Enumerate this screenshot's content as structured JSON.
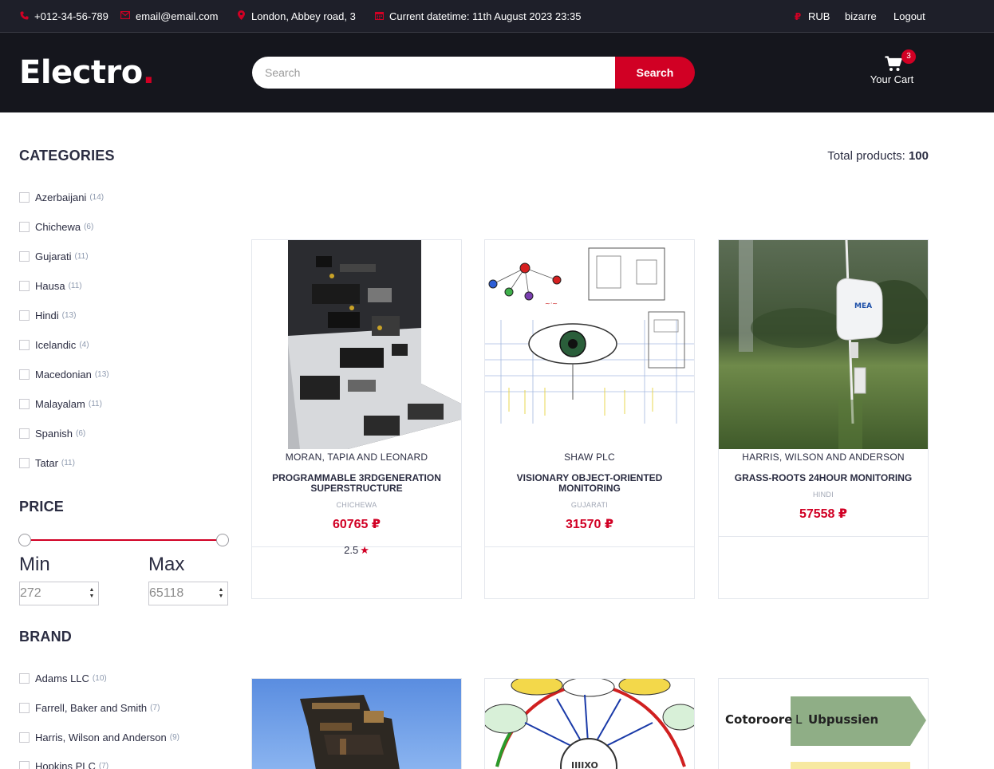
{
  "topbar": {
    "phone": "+012-34-56-789",
    "email": "email@email.com",
    "address": "London, Abbey road, 3",
    "datetime": "Current datetime: 11th August 2023 23:35",
    "currency": "RUB",
    "username": "bizarre",
    "logout": "Logout"
  },
  "header": {
    "logo_text": "Electro",
    "logo_dot": ".",
    "search_placeholder": "Search",
    "search_button": "Search",
    "cart_count": "3",
    "cart_label": "Your Cart"
  },
  "sidebar": {
    "categories_title": "CATEGORIES",
    "categories": [
      {
        "label": "Azerbaijani",
        "count": "(14)"
      },
      {
        "label": "Chichewa",
        "count": "(6)"
      },
      {
        "label": "Gujarati",
        "count": "(11)"
      },
      {
        "label": "Hausa",
        "count": "(11)"
      },
      {
        "label": "Hindi",
        "count": "(13)"
      },
      {
        "label": "Icelandic",
        "count": "(4)"
      },
      {
        "label": "Macedonian",
        "count": "(13)"
      },
      {
        "label": "Malayalam",
        "count": "(11)"
      },
      {
        "label": "Spanish",
        "count": "(6)"
      },
      {
        "label": "Tatar",
        "count": "(11)"
      }
    ],
    "price_title": "PRICE",
    "min_label": "Min",
    "max_label": "Max",
    "min_value": "272",
    "max_value": "65118",
    "brand_title": "BRAND",
    "brands": [
      {
        "label": "Adams LLC",
        "count": "(10)"
      },
      {
        "label": "Farrell, Baker and Smith",
        "count": "(7)"
      },
      {
        "label": "Harris, Wilson and Anderson",
        "count": "(9)"
      },
      {
        "label": "Hopkins PLC",
        "count": "(7)"
      }
    ]
  },
  "main": {
    "total_label": "Total products:",
    "total_value": "100",
    "products": [
      {
        "brand": "Moran, Tapia and Leonard",
        "name": "Programmable 3rdgeneration superstructure",
        "category": "Chichewa",
        "price": "60765 ₽",
        "rating": "2.5"
      },
      {
        "brand": "Shaw PLC",
        "name": "Visionary object-oriented monitoring",
        "category": "Gujarati",
        "price": "31570 ₽"
      },
      {
        "brand": "Harris, Wilson and Anderson",
        "name": "Grass-roots 24hour monitoring",
        "category": "Hindi",
        "price": "57558 ₽"
      }
    ],
    "partial_image_texts": [
      "Cotoroore",
      "L",
      "Ubpussien"
    ]
  },
  "colors": {
    "accent": "#D10024",
    "dark": "#15161d",
    "topbar": "#1e1f29"
  },
  "icons": [
    "phone-icon",
    "envelope-icon",
    "map-marker-icon",
    "calendar-icon",
    "ruble-icon",
    "cart-icon",
    "star-icon"
  ]
}
